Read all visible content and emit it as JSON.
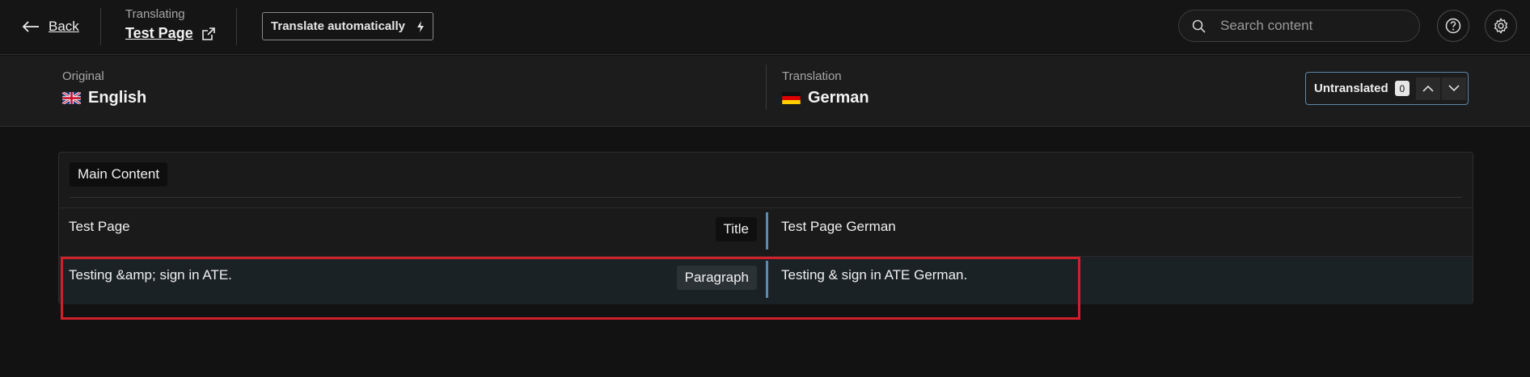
{
  "topbar": {
    "back_label": "Back",
    "translating_label": "Translating",
    "page_name": "Test Page",
    "translate_auto_label": "Translate automatically",
    "search_placeholder": "Search content"
  },
  "languages": {
    "original_label": "Original",
    "original_name": "English",
    "translation_label": "Translation",
    "translation_name": "German",
    "untranslated_label": "Untranslated",
    "untranslated_count": "0"
  },
  "section": {
    "title": "Main Content",
    "rows": [
      {
        "source": "Test Page",
        "type": "Title",
        "target": "Test Page German"
      },
      {
        "source": "Testing &amp; sign in ATE.",
        "type": "Paragraph",
        "target": "Testing & sign in ATE German."
      }
    ]
  },
  "colors": {
    "accent": "#5a8db5",
    "highlight": "#d0202a",
    "background": "#121212"
  }
}
